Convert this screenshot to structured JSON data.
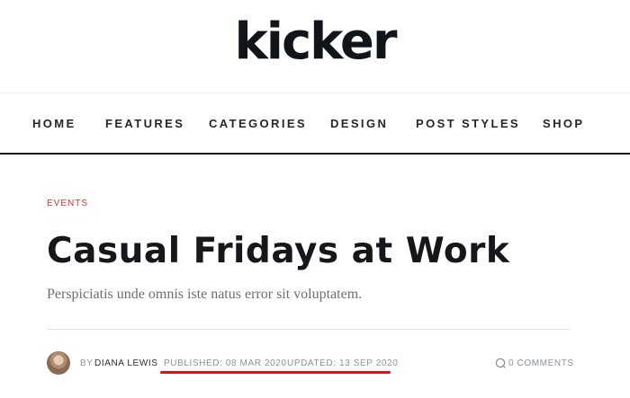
{
  "site": {
    "logo_text": "kicker"
  },
  "nav": {
    "items": [
      {
        "label": "HOME"
      },
      {
        "label": "FEATURES"
      },
      {
        "label": "CATEGORIES"
      },
      {
        "label": "DESIGN"
      },
      {
        "label": "POST STYLES"
      },
      {
        "label": "SHOP"
      }
    ]
  },
  "article": {
    "category": "EVENTS",
    "title": "Casual Fridays at Work",
    "subtitle": "Perspiciatis unde omnis iste natus error sit voluptatem.",
    "meta": {
      "by_label": "BY",
      "author": "DIANA LEWIS",
      "published": "PUBLISHED: 08 MAR 2020",
      "updated": "UPDATED: 13 SEP 2020",
      "comments": "0 COMMENTS"
    }
  },
  "colors": {
    "accent": "#d0342c",
    "highlight_underline": "#d8121b",
    "text_dark": "#15171b",
    "text_muted": "#8d9197"
  }
}
